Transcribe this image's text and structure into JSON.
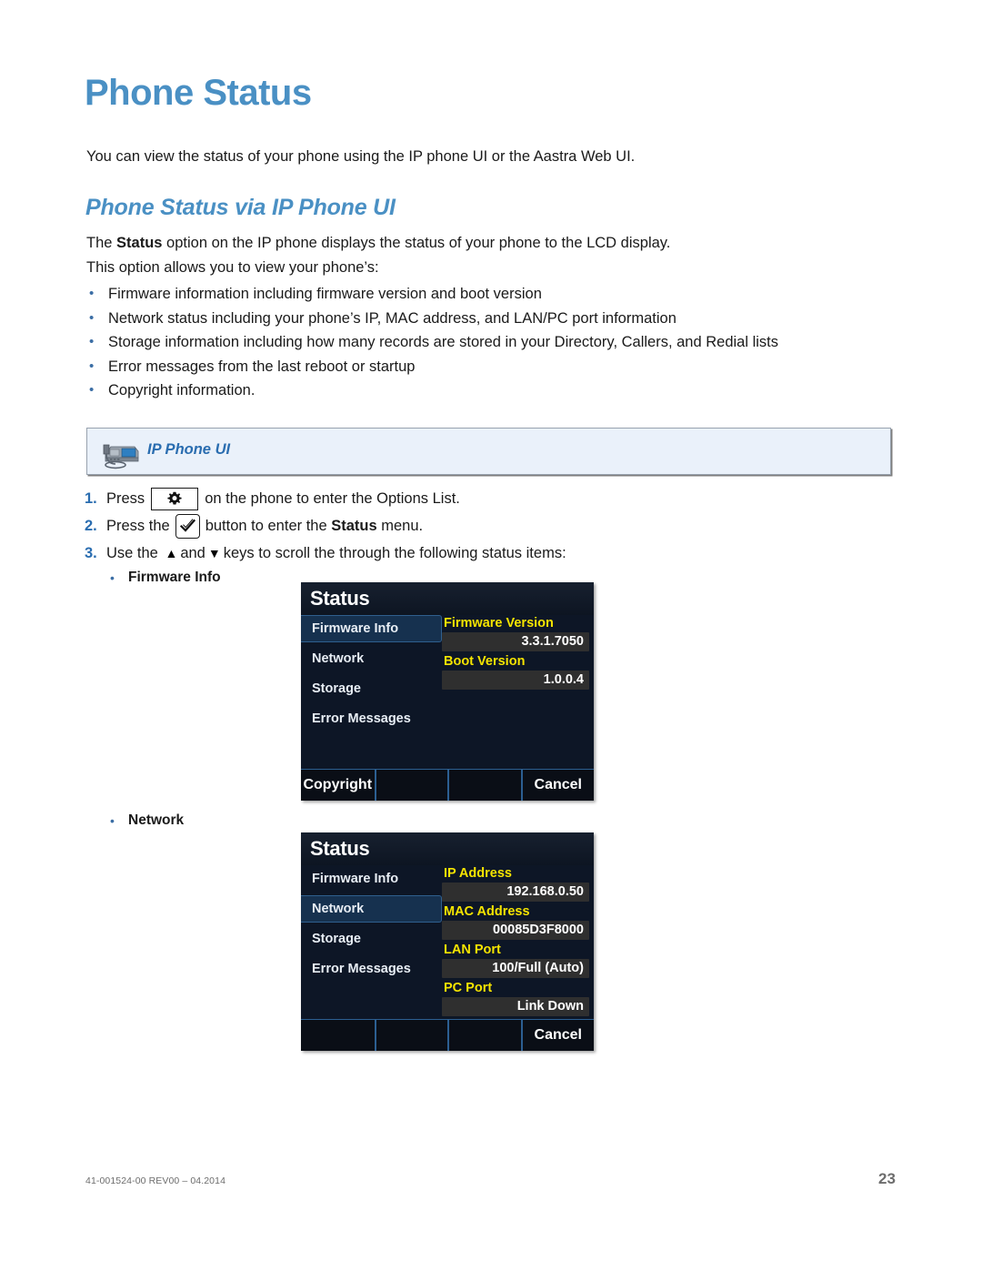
{
  "page": {
    "title": "Phone Status",
    "intro": "You can view the status of your phone using the IP phone UI or the Aastra Web UI.",
    "section_heading": "Phone Status via IP Phone UI",
    "para_status_prefix": "The ",
    "para_status_bold": "Status",
    "para_status_suffix": " option on the IP phone displays the status of your phone to the LCD display.",
    "para_allows": "This option allows you to view your phone’s:",
    "bullets": [
      "Firmware information including firmware version and boot version",
      "Network status including your phone’s IP, MAC address, and LAN/PC port information",
      "Storage information including how many records are stored in your Directory, Callers, and Redial lists",
      "Error messages from the last reboot or startup",
      "Copyright information."
    ],
    "bullet_marker": "•"
  },
  "callout": {
    "label": "IP Phone UI",
    "icon": "ip-phone-icon"
  },
  "steps": [
    {
      "number": "1.",
      "text_before": "Press",
      "key_icon": "gear-icon",
      "text_after": "on the phone to enter the Options List."
    },
    {
      "number": "2.",
      "text_before": "Press the",
      "key_icon": "checkmark-icon",
      "text_after_prefix": "button to enter the ",
      "text_after_bold": "Status",
      "text_after_suffix": " menu."
    },
    {
      "number": "3.",
      "text_before": "Use the",
      "arrow_up": "▲",
      "text_mid": "and",
      "arrow_down": "▼",
      "text_after": "keys to scroll the through the following status items:"
    }
  ],
  "status_items": [
    {
      "label": "Firmware Info"
    },
    {
      "label": "Network"
    }
  ],
  "lcd_firmware": {
    "title": "Status",
    "menu": [
      "Firmware Info",
      "Network",
      "Storage",
      "Error Messages"
    ],
    "selected_index": 0,
    "fields": [
      {
        "label": "Firmware Version",
        "value": "3.3.1.7050"
      },
      {
        "label": "Boot Version",
        "value": "1.0.0.4"
      }
    ],
    "softkeys": [
      "Copyright",
      "",
      "",
      "Cancel"
    ]
  },
  "lcd_network": {
    "title": "Status",
    "menu": [
      "Firmware Info",
      "Network",
      "Storage",
      "Error Messages"
    ],
    "selected_index": 1,
    "fields": [
      {
        "label": "IP Address",
        "value": "192.168.0.50"
      },
      {
        "label": "MAC Address",
        "value": "00085D3F8000"
      },
      {
        "label": "LAN Port",
        "value": "100/Full (Auto)"
      },
      {
        "label": "PC Port",
        "value": "Link Down"
      }
    ],
    "softkeys": [
      "",
      "",
      "",
      "Cancel"
    ]
  },
  "footer": {
    "doc_id": "41-001524-00 REV00 – 04.2014",
    "page_number": "23"
  },
  "colors": {
    "heading_blue": "#4a90c4",
    "callout_blue": "#2a6db0",
    "callout_bg": "#eaf1fa",
    "lcd_bg": "#0d1626",
    "lcd_label_yellow": "#f5e400",
    "lcd_selected": "#16314f"
  }
}
